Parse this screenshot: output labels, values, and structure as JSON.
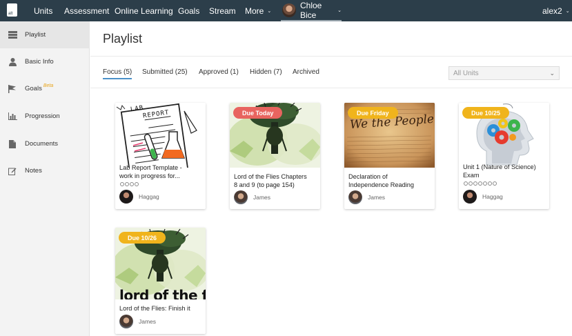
{
  "topnav": {
    "logo_text": "alt",
    "items": [
      "Units",
      "Assessment",
      "Online Learning",
      "Goals",
      "Stream",
      "More"
    ],
    "user_name": "Chloe Bice",
    "account": "alex2"
  },
  "sidebar": {
    "items": [
      {
        "label": "Playlist",
        "icon": "list-icon",
        "active": true
      },
      {
        "label": "Basic Info",
        "icon": "person-icon"
      },
      {
        "label": "Goals",
        "icon": "flag-icon",
        "badge": "Beta"
      },
      {
        "label": "Progression",
        "icon": "bar-chart-icon"
      },
      {
        "label": "Documents",
        "icon": "document-icon"
      },
      {
        "label": "Notes",
        "icon": "edit-icon"
      }
    ]
  },
  "main": {
    "title": "Playlist",
    "tabs": [
      "Focus (5)",
      "Submitted (25)",
      "Approved (1)",
      "Hidden (7)",
      "Archived"
    ],
    "active_tab": "Focus (5)",
    "units_select": "All Units"
  },
  "colors": {
    "topbar": "#2c3e4a",
    "due_today": "#e8645f",
    "due_date": "#f0b41c",
    "tab_underline": "#4a90c8"
  },
  "cards": [
    {
      "title_lines": [
        "Lab Report Template -",
        "work in progress for..."
      ],
      "badge": "",
      "progress_dots": 4,
      "author": "Haggag",
      "image": "lab-report"
    },
    {
      "title_lines": [
        "Lord of the Flies Chapters",
        "8 and 9 (to page 154)"
      ],
      "badge": "Due Today",
      "progress_dots": 0,
      "author": "James",
      "image": "flies-cover"
    },
    {
      "title_lines": [
        "Declaration of",
        "Independence Reading"
      ],
      "badge": "Due Friday",
      "progress_dots": 0,
      "author": "James",
      "image": "we-the-people"
    },
    {
      "title_lines": [
        "Unit 1 (Nature of Science)",
        "Exam"
      ],
      "badge": "Due 10/25",
      "progress_dots": 7,
      "author": "Haggag",
      "image": "brain-gears"
    },
    {
      "title_lines": [
        "Lord of the Flies: Finish it"
      ],
      "badge": "Due 10/26",
      "progress_dots": 0,
      "author": "James",
      "image": "flies-cover-text"
    }
  ],
  "image_text": {
    "lab_heading_1": "LAB",
    "lab_heading_2": "REPORT",
    "we_the_people": "We the People",
    "flies_text": "lord of the fli"
  }
}
